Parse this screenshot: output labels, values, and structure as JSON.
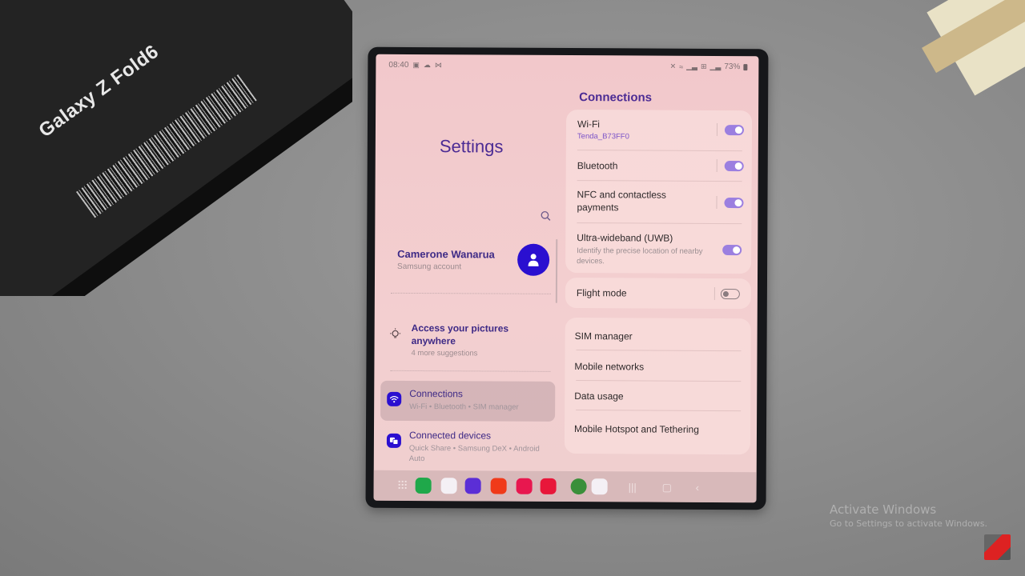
{
  "background": {
    "box_label": "Galaxy Z Fold6",
    "watermark": {
      "title": "Activate Windows",
      "subtitle": "Go to Settings to activate Windows."
    }
  },
  "statusbar": {
    "time": "08:40",
    "left_icons": [
      "gallery-icon",
      "cloud-icon",
      "voicemail-icon"
    ],
    "right_icons": [
      "mute-icon",
      "wifi-icon",
      "signal-icon",
      "volte-icon",
      "signal-icon"
    ],
    "battery": "73%"
  },
  "left_pane": {
    "title": "Settings",
    "profile": {
      "name": "Camerone Wanarua",
      "subtitle": "Samsung account"
    },
    "suggestion": {
      "title": "Access your pictures anywhere",
      "subtitle": "4 more suggestions"
    },
    "nav_items": [
      {
        "title": "Connections",
        "subtitle": "Wi-Fi  •  Bluetooth  •  SIM manager",
        "active": true
      },
      {
        "title": "Connected devices",
        "subtitle": "Quick Share  •  Samsung DeX  •  Android Auto",
        "active": false
      }
    ]
  },
  "right_pane": {
    "title": "Connections",
    "toggles": [
      {
        "title": "Wi-Fi",
        "subtitle": "Tenda_B73FF0",
        "on": true
      },
      {
        "title": "Bluetooth",
        "on": true
      },
      {
        "title": "NFC and contactless payments",
        "on": true
      },
      {
        "title": "Ultra-wideband (UWB)",
        "description": "Identify the precise location of nearby devices.",
        "on": true
      }
    ],
    "flight_mode": {
      "title": "Flight mode",
      "on": false
    },
    "menu": [
      "SIM manager",
      "Mobile networks",
      "Data usage",
      "Mobile Hotspot and Tethering"
    ]
  },
  "taskbar": {
    "apps": [
      {
        "name": "phone",
        "color": "#1fa84a"
      },
      {
        "name": "messages",
        "color": "#f4f0f5"
      },
      {
        "name": "internet",
        "color": "#5b2ed6"
      },
      {
        "name": "notes",
        "color": "#f03a1a"
      },
      {
        "name": "gallery",
        "color": "#e8174f"
      },
      {
        "name": "camera",
        "color": "#e8173a"
      },
      {
        "name": "spotify",
        "color": "#3a8f3a"
      },
      {
        "name": "play-store",
        "color": "#f4f0f5"
      }
    ]
  },
  "colors": {
    "accent": "#4b2b94",
    "toggle_on": "#9b7fe0",
    "avatar": "#2a0fd0"
  }
}
